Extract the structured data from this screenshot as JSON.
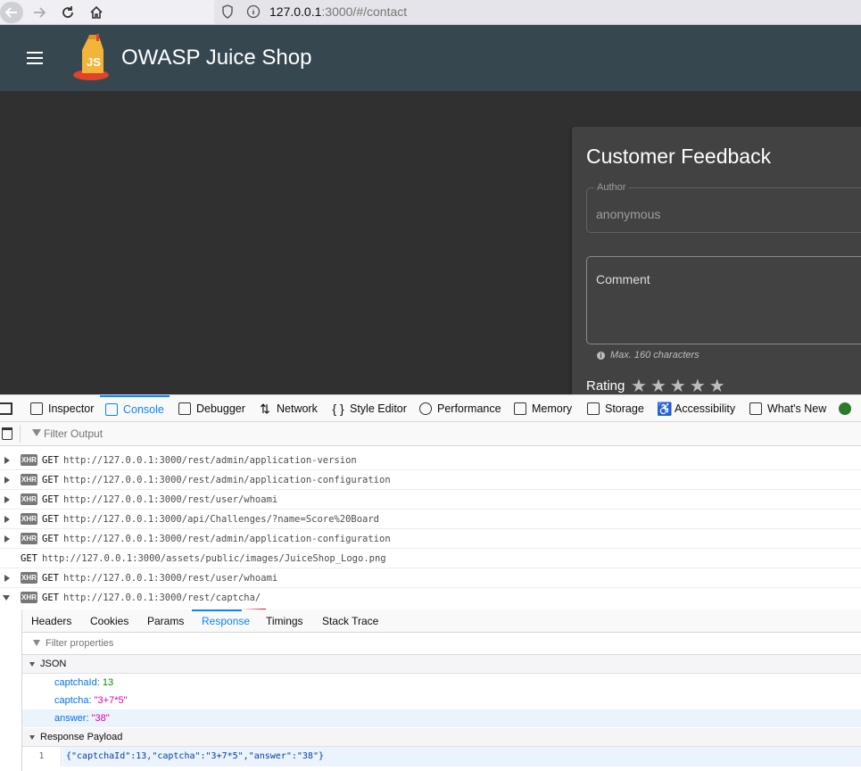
{
  "browser": {
    "url_host": "127.0.0.1",
    "url_rest": ":3000/#/contact"
  },
  "app": {
    "title": "OWASP Juice Shop",
    "logo_text": "JS"
  },
  "feedback": {
    "title": "Customer Feedback",
    "author_label": "Author",
    "author_value": "anonymous",
    "comment_label": "Comment",
    "hint": "Max. 160 characters",
    "hint_icon": "i",
    "rating_label": "Rating",
    "stars": [
      "★",
      "★",
      "★",
      "★",
      "★"
    ]
  },
  "devtools": {
    "tabs": [
      {
        "label": "Inspector",
        "icon": "inspector-icon"
      },
      {
        "label": "Console",
        "icon": "console-icon",
        "active": true
      },
      {
        "label": "Debugger",
        "icon": "debugger-icon"
      },
      {
        "label": "Network",
        "icon": "network-icon"
      },
      {
        "label": "Style Editor",
        "icon": "style-editor-icon"
      },
      {
        "label": "Performance",
        "icon": "performance-icon"
      },
      {
        "label": "Memory",
        "icon": "memory-icon"
      },
      {
        "label": "Storage",
        "icon": "storage-icon"
      },
      {
        "label": "Accessibility",
        "icon": "accessibility-icon"
      },
      {
        "label": "What's New",
        "icon": "gift-icon"
      }
    ],
    "tab_glyphs": [
      "{ }"
    ],
    "filter_placeholder": "Filter Output",
    "accent": "#0a84ff"
  },
  "console_log": [
    {
      "badge": "XHR",
      "method": "GET",
      "url": "http://127.0.0.1:3000/rest/admin/application-version"
    },
    {
      "badge": "XHR",
      "method": "GET",
      "url": "http://127.0.0.1:3000/rest/admin/application-configuration"
    },
    {
      "badge": "XHR",
      "method": "GET",
      "url": "http://127.0.0.1:3000/rest/user/whoami"
    },
    {
      "badge": "XHR",
      "method": "GET",
      "url": "http://127.0.0.1:3000/api/Challenges/?name=Score%20Board"
    },
    {
      "badge": "XHR",
      "method": "GET",
      "url": "http://127.0.0.1:3000/rest/admin/application-configuration"
    },
    {
      "badge": "",
      "method": "GET",
      "url": "http://127.0.0.1:3000/assets/public/images/JuiceShop_Logo.png"
    },
    {
      "badge": "XHR",
      "method": "GET",
      "url": "http://127.0.0.1:3000/rest/user/whoami"
    },
    {
      "badge": "XHR",
      "method": "GET",
      "url": "http://127.0.0.1:3000/rest/captcha/",
      "expanded": true
    }
  ],
  "details": {
    "tabs": [
      "Headers",
      "Cookies",
      "Params",
      "Response",
      "Timings",
      "Stack Trace"
    ],
    "active_tab": "Response",
    "filter_placeholder": "Filter properties",
    "json_section": "JSON",
    "json": [
      {
        "key": "captchaId",
        "value": "13",
        "type": "number"
      },
      {
        "key": "captcha",
        "value": "\"3+7*5\"",
        "type": "string"
      },
      {
        "key": "answer",
        "value": "\"38\"",
        "type": "string"
      }
    ],
    "payload_section": "Response Payload",
    "payload_line_no": "1",
    "payload": "{\"captchaId\":13,\"captcha\":\"3+7*5\",\"answer\":\"38\"}"
  }
}
